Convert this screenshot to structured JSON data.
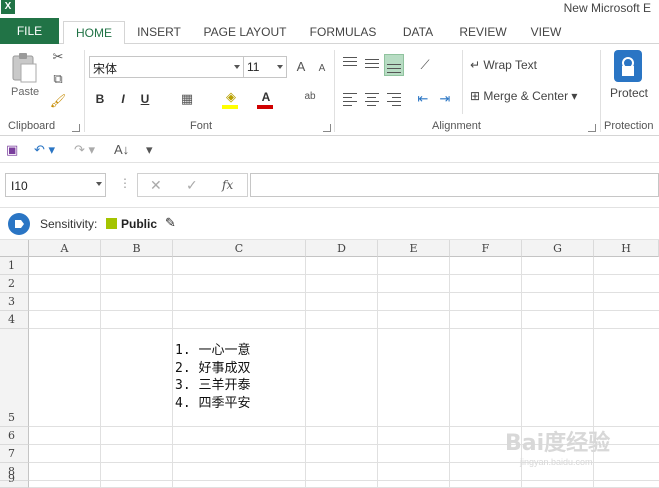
{
  "window": {
    "title": "New Microsoft E"
  },
  "tabs": [
    "FILE",
    "HOME",
    "INSERT",
    "PAGE LAYOUT",
    "FORMULAS",
    "DATA",
    "REVIEW",
    "VIEW"
  ],
  "active_tab": "HOME",
  "ribbon": {
    "clipboard": {
      "paste_label": "Paste",
      "group_label": "Clipboard"
    },
    "font": {
      "font_name": "宋体",
      "font_size": "11",
      "bold": "B",
      "italic": "I",
      "underline": "U",
      "group_label": "Font",
      "grow": "A",
      "shrink": "A",
      "font_color_letter": "A"
    },
    "alignment": {
      "wrap_text": "Wrap Text",
      "merge_center": "Merge & Center",
      "group_label": "Alignment"
    },
    "protection": {
      "protect_label": "Protect",
      "group_label": "Protection"
    }
  },
  "formula_bar": {
    "name_box": "I10",
    "fx_label": "fx",
    "cancel": "✕",
    "enter": "✓",
    "formula": ""
  },
  "sensitivity": {
    "label": "Sensitivity:",
    "value": "Public",
    "swatch_color": "#a4c400"
  },
  "grid": {
    "columns": [
      "A",
      "B",
      "C",
      "D",
      "E",
      "F",
      "G",
      "H"
    ],
    "rows": [
      "1",
      "2",
      "3",
      "4",
      "5",
      "6",
      "7",
      "8",
      "9"
    ],
    "cell_C5": [
      "1. 一心一意",
      "2. 好事成双",
      "3. 三羊开泰",
      "4. 四季平安"
    ]
  },
  "watermark": {
    "text": "Bai度经验",
    "sub": "jingyan.baidu.com"
  },
  "colors": {
    "accent": "#217346",
    "selected_align": "#b7dcc3",
    "font_color_bar": "#d00000",
    "protect_blue": "#2a75c4"
  },
  "icons": [
    "excel-logo",
    "cut-icon",
    "copy-icon",
    "format-painter-icon",
    "border-icon",
    "fill-color-icon",
    "font-color-icon",
    "wrap-text-icon",
    "merge-icon",
    "lock-icon",
    "save-icon",
    "undo-icon",
    "redo-icon",
    "sort-icon",
    "pencil-icon"
  ]
}
